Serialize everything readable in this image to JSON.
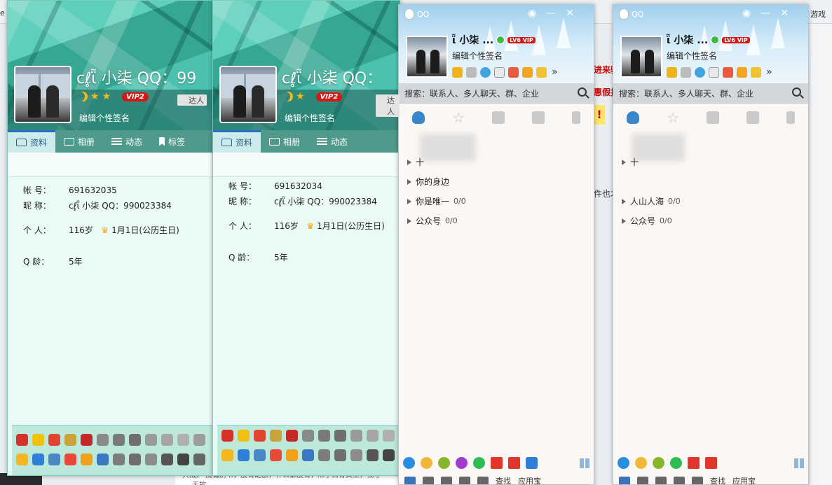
{
  "background": {
    "left_edge_text": "e",
    "games_text": "游戏",
    "red_text_1": "进来驱",
    "red_text_2": "惠假拈",
    "alert_mark": "!",
    "side_text": "件也才",
    "bottom_text_1": "大战》 度有历书，度有配额，什么都度有，除了白骨黄土，我守",
    "bottom_text_2": "无故"
  },
  "profile_cards": [
    {
      "nickname": "cℓ̥ῗ 小柒 QQ：99",
      "signature": "编辑个性签名",
      "vip_label": "VIP2",
      "daren_label": "达人",
      "tabs": [
        {
          "label": "资料",
          "active": true
        },
        {
          "label": "相册",
          "active": false
        },
        {
          "label": "动态",
          "active": false
        },
        {
          "label": "标签",
          "active": false
        }
      ],
      "account_label": "帐    号：",
      "account_value": "691632035",
      "nick_label": "昵    称：",
      "nick_value": "cℓ̥ῗ 小柒 QQ：990023384",
      "person_label": "个    人：",
      "age_value": "116岁",
      "birthday_value": "1月1日(公历生日)",
      "qage_label": "Q    龄：",
      "qage_value": "5年"
    },
    {
      "nickname": "cℓ̥ῗ 小柒 QQ：",
      "signature": "编辑个性签名",
      "vip_label": "VIP2",
      "daren_label": "达人",
      "tabs": [
        {
          "label": "资料",
          "active": true
        },
        {
          "label": "相册",
          "active": false
        },
        {
          "label": "动态",
          "active": false
        }
      ],
      "account_label": "帐    号：",
      "account_value": "691632034",
      "nick_label": "昵    称：",
      "nick_value": "cℓ̥ῗ 小柒 QQ：990023384",
      "person_label": "个    人：",
      "age_value": "116岁",
      "birthday_value": "1月1日(公历生日)",
      "qage_label": "Q    龄：",
      "qage_value": "5年"
    }
  ],
  "qq_panels": [
    {
      "title": "QQ",
      "nickname": "ῗ 小柒 ...",
      "level_badge": "LV6 VIP",
      "signature": "编辑个性签名",
      "search_placeholder": "搜索：联系人、多人聊天、群、企业",
      "groups": [
        {
          "name": "十",
          "count": ""
        },
        {
          "name": "你的身边",
          "count": ""
        },
        {
          "name": "你是唯一",
          "count": "0/0"
        },
        {
          "name": "公众号",
          "count": "0/0"
        }
      ],
      "find_label": "查找",
      "appstore_label": "应用宝",
      "brand_colors": {
        "header": "#9fd0ee",
        "search_bar": "#d3d7db"
      }
    },
    {
      "title": "QQ",
      "nickname": "ῗ 小柒 ...",
      "level_badge": "LV6 VIP",
      "signature": "编辑个性签名",
      "search_placeholder": "搜索：联系人、多人聊天、群、企业",
      "groups": [
        {
          "name": "十",
          "count": ""
        },
        {
          "name": "人山人海",
          "count": "0/0"
        },
        {
          "name": "公众号",
          "count": "0/0"
        }
      ],
      "find_label": "查找",
      "appstore_label": "应用宝",
      "brand_colors": {
        "header": "#9fd0ee",
        "search_bar": "#d3d7db"
      }
    }
  ]
}
